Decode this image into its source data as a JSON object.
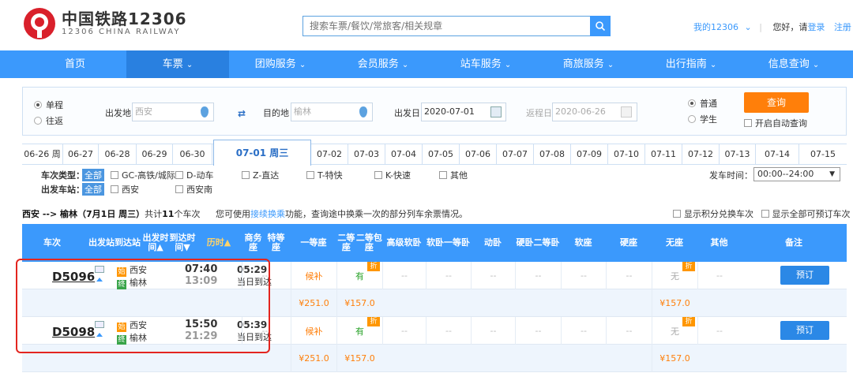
{
  "header": {
    "logo_cn": "中国铁路12306",
    "logo_en": "12306 CHINA RAILWAY",
    "search_placeholder": "搜索车票/餐饮/常旅客/相关规章",
    "my12306": "我的12306",
    "greeting": "您好，请",
    "login": "登录",
    "register": "注册"
  },
  "nav": [
    "首页",
    "车票",
    "团购服务",
    "会员服务",
    "站车服务",
    "商旅服务",
    "出行指南",
    "信息查询"
  ],
  "query": {
    "one_way": "单程",
    "round_trip": "往返",
    "from_label": "出发地",
    "from_value": "西安",
    "to_label": "目的地",
    "to_value": "榆林",
    "depart_label": "出发日",
    "depart_value": "2020-07-01",
    "return_label": "返程日",
    "return_value": "2020-06-26",
    "adult": "普通",
    "student": "学生",
    "search_btn": "查询",
    "auto_query": "开启自动查询"
  },
  "dates": [
    "06-26 周",
    "06-27",
    "06-28",
    "06-29",
    "06-30",
    "07-01 周三",
    "07-02",
    "07-03",
    "07-04",
    "07-05",
    "07-06",
    "07-07",
    "07-08",
    "07-09",
    "07-10",
    "07-11",
    "07-12",
    "07-13",
    "07-14",
    "07-15"
  ],
  "filter": {
    "type_label": "车次类型：",
    "all": "全部",
    "types": [
      "GC-高铁/城际",
      "D-动车",
      "Z-直达",
      "T-特快",
      "K-快速",
      "其他"
    ],
    "station_label": "出发车站：",
    "stations": [
      "西安",
      "西安南"
    ],
    "time_label": "发车时间：",
    "time_value": "00:00--24:00"
  },
  "summary": {
    "route": "西安 --> 榆林（7月1日 周三）",
    "count_pre": "共计",
    "count": "11",
    "count_post": "个车次",
    "tip_pre": "您可使用",
    "tip_link": "接续换乘",
    "tip_post": "功能，查询途中换乘一次的部分列车余票情况。",
    "opt1": "显示积分兑换车次",
    "opt2": "显示全部可预订车次"
  },
  "columns": [
    "车次",
    "出发站\n到达站",
    "出发时间▲\n到达时间▼",
    "历时▲",
    "商务座\n特等座",
    "一等座",
    "二等座\n二等包座",
    "高级\n软卧",
    "软卧\n一等卧",
    "动卧",
    "硬卧\n二等卧",
    "软座",
    "硬座",
    "无座",
    "其他",
    "备注"
  ],
  "trains": [
    {
      "no": "D5096",
      "from_badge": "始",
      "from": "西安",
      "to_badge": "终",
      "to": "榆林",
      "dep": "07:40",
      "arr": "13:09",
      "dur": "05:29",
      "arrive_day": "当日到达",
      "business": "--",
      "first": "候补",
      "second": "有",
      "soft_hi": "--",
      "soft": "--",
      "dong": "--",
      "hard": "--",
      "soft_seat": "--",
      "hard_seat": "--",
      "none": "无",
      "other": "--",
      "book": "预订",
      "price_first": "¥251.0",
      "price_second": "¥157.0",
      "price_none": "¥157.0",
      "zhe": "折"
    },
    {
      "no": "D5098",
      "from_badge": "始",
      "from": "西安",
      "to_badge": "终",
      "to": "榆林",
      "dep": "15:50",
      "arr": "21:29",
      "dur": "05:39",
      "arrive_day": "当日到达",
      "business": "--",
      "first": "候补",
      "second": "有",
      "soft_hi": "--",
      "soft": "--",
      "dong": "--",
      "hard": "--",
      "soft_seat": "--",
      "hard_seat": "--",
      "none": "无",
      "other": "--",
      "book": "预订",
      "price_first": "¥251.0",
      "price_second": "¥157.0",
      "price_none": "¥157.0",
      "zhe": "折"
    }
  ],
  "colors": {
    "blue": "#3b99fc",
    "orange": "#ff7f0a",
    "green": "#2aa32a",
    "red_box": "#e3251f"
  }
}
